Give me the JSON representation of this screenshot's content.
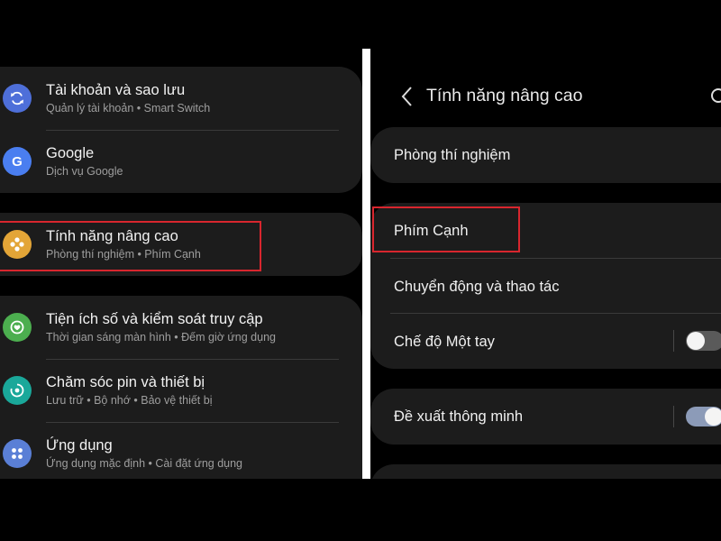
{
  "left_panel": {
    "items": [
      {
        "title": "Tài khoản và sao lưu",
        "subtitle": "Quản lý tài khoản  •  Smart Switch",
        "icon": "sync-icon",
        "icon_color": "#4e6fd9"
      },
      {
        "title": "Google",
        "subtitle": "Dịch vụ Google",
        "icon": "google-g-icon",
        "icon_color": "#4a7ef0"
      },
      {
        "title": "Tính năng nâng cao",
        "subtitle": "Phòng thí nghiệm  •  Phím Cạnh",
        "icon": "advanced-features-icon",
        "icon_color": "#e3a537"
      },
      {
        "title": "Tiện ích số và kiểm soát truy cập",
        "subtitle": "Thời gian sáng màn hình  •  Đếm giờ ứng dụng",
        "icon": "digital-wellbeing-icon",
        "icon_color": "#4cae4f"
      },
      {
        "title": "Chăm sóc pin và thiết bị",
        "subtitle": "Lưu trữ  •  Bộ nhớ  •  Bảo vệ thiết bị",
        "icon": "device-care-icon",
        "icon_color": "#1aa89a"
      },
      {
        "title": "Ứng dụng",
        "subtitle": "Ứng dụng mặc định  •  Cài đặt ứng dụng",
        "icon": "apps-icon",
        "icon_color": "#5a7fd6"
      }
    ]
  },
  "right_panel": {
    "header_title": "Tính năng nâng cao",
    "rows": [
      {
        "label": "Phòng thí nghiệm"
      },
      {
        "label": "Phím Cạnh"
      },
      {
        "label": "Chuyển động và thao tác"
      },
      {
        "label": "Chế độ Một tay",
        "toggle": "off"
      },
      {
        "label": "Đề xuất thông minh",
        "toggle": "on"
      }
    ]
  },
  "colors": {
    "highlight": "#d8262e",
    "card": "#1c1c1c",
    "toggle_on": "#8c9bb8",
    "toggle_off": "#5a5a5a"
  }
}
